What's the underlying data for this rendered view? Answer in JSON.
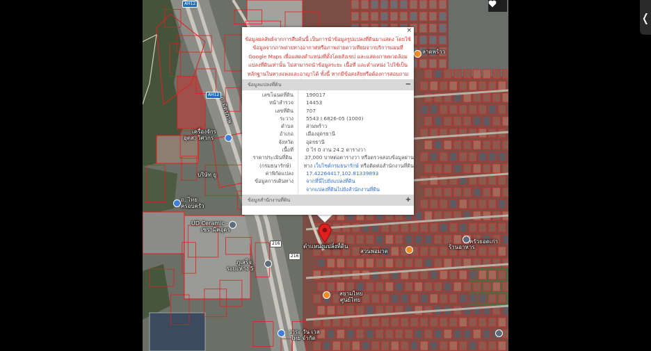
{
  "map": {
    "road_shields": [
      "AH12",
      "AH12",
      "216",
      "216"
    ],
    "labels": [
      "ถ. มิตรภาพ",
      "เครื่องจักร",
      "อุตส. วิศวกร",
      "บริษัท ยู",
      "ถ. ไทย",
      "ครอบครัว",
      "UD Ceramic -",
      "เซรามิคอุดร",
      "ภูเสร็จ",
      "ระยะห่าง 5",
      "ลาดพร้าว",
      "ครัวยอดเก่า",
      "ตลาดเอี่ยม",
      "ร้านอาหาร",
      "สวนพอมาต",
      "สยามไทย",
      "ศูนย์ไทย",
      "วาระ วัน เวล",
      "ไทย จำกัด"
    ],
    "pin_label": "ตำแหน่งแปลงที่ดิน",
    "favorite_icon": "heart-icon",
    "pin_icon": "map-pin-icon"
  },
  "popup": {
    "close_label": "×",
    "disclaimer": "ข้อมูลผลลัพธ์จากการสืบค้นนี้ เป็นการนำข้อมูลรูปแปลงที่ดินมาแสดง โดยใช้ข้อมูลจากภาพถ่ายทางอากาศหรือภาพถ่ายดาวเทียมจากบริการแผนที่ Google Maps เพื่อแสดงตำแหน่งที่ตั้งโดยสังเขป และแสดงภาพพวดล้อมแปลงที่ดินเท่านั้น ไม่สามารถนำข้อมูลระยะ เนื้อที่ และตำแหน่ง ไปใช้เป็นหลักฐานในทางแพ่งและอาญาได้ ทั้งนี้ หากมีข้อสงสัยหรือต้องการสอบถามข้อมูลเพิ่มเติม โปรดติดต่อสำนักงานที่ดิน",
    "section_parcel": "ข้อมูลแปลงที่ดิน",
    "section_parcel_toggle": "−",
    "section_office": "ข้อมูลสำนักงานที่ดิน",
    "section_office_toggle": "+",
    "rows": [
      {
        "key": "เลขโฉนดที่ดิน",
        "value": "190017"
      },
      {
        "key": "หน้าสำรวจ",
        "value": "14453"
      },
      {
        "key": "เลขที่ดิน",
        "value": "707"
      },
      {
        "key": "ระวาง",
        "value": "5543 I 6826-05 (1000)"
      },
      {
        "key": "ตำบล",
        "value": "สามพร้าว"
      },
      {
        "key": "อำเภอ",
        "value": "เมืองอุดรธานี"
      },
      {
        "key": "จังหวัด",
        "value": "อุดรธานี"
      },
      {
        "key": "เนื้อที่",
        "value": "0 ไร่ 0 งาน 24.2 ตารางวา"
      }
    ],
    "price_key_1": "ราคาประเมินที่ดิน",
    "price_key_2": "(กรมธนารักษ์)",
    "price_value_1": "37,000 บาทต่อตารางวา หรือตรวจสอบข้อมูลผ่าน",
    "price_value_2_pre": "ทาง",
    "price_link": "เว็บไซต์กรมธนารักษ์",
    "price_value_2_post": "หรือติดต่อสำนักงานที่ดิน",
    "coord_key": "ค่าพิกัดแปลง",
    "coord_value": "17.42264417,102.81339893",
    "route_key": "ข้อมูลการเดินทาง",
    "route_link_1": "จากที่นี่ไปยังแปลงที่ดิน",
    "route_link_2": "จากแปลงที่ดินไปยังสำนักงานที่ดิน"
  },
  "side_tab": {
    "label": "❬"
  },
  "colors": {
    "disclaimer": "#e4322b",
    "link": "#2e6ee6",
    "parcel_line": "#e02020",
    "button_green": "#2db35d",
    "button_blue": "#3b82e0",
    "button_red": "#e23b3b",
    "pin": "#e02020"
  }
}
